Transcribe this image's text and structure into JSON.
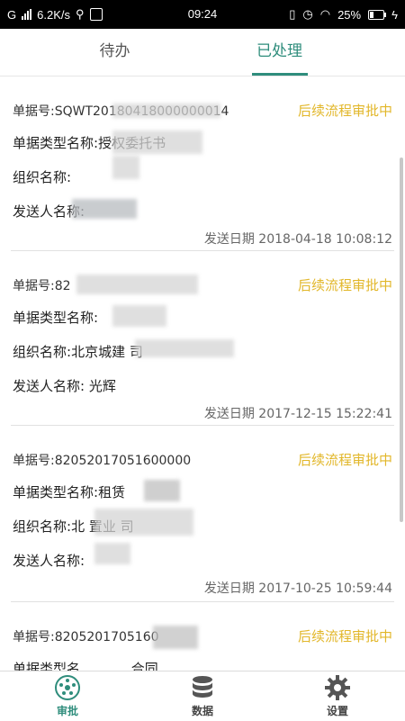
{
  "status_bar": {
    "carrier": "G",
    "speed": "6.2K/s",
    "time": "09:24",
    "battery": "25%"
  },
  "tabs": [
    {
      "label": "待办"
    },
    {
      "label": "已处理"
    }
  ],
  "items": [
    {
      "doc_no_label": "单据号:",
      "doc_no": "SQWT20180418000000014",
      "status": "后续流程审批中",
      "type_label": "单据类型名称:",
      "type_value": "授权委托书",
      "org_label": "组织名称:",
      "org_value": "",
      "sender_label": "发送人名称:",
      "sender_value": "",
      "date": "发送日期 2018-04-18 10:08:12"
    },
    {
      "doc_no_label": "单据号:",
      "doc_no": "82",
      "status": "后续流程审批中",
      "type_label": "单据类型名称:",
      "type_value": "",
      "org_label": "组织名称:",
      "org_value": "北京城建          司",
      "sender_label": "发送人名称:",
      "sender_value": "     光辉",
      "date": "发送日期 2017-12-15 15:22:41"
    },
    {
      "doc_no_label": "单据号:",
      "doc_no": "82052017051600000",
      "status": "后续流程审批中",
      "type_label": "单据类型名称:",
      "type_value": "租赁",
      "org_label": "组织名称:",
      "org_value": "北      置业      司",
      "sender_label": "发送人名称:",
      "sender_value": "",
      "date": "发送日期 2017-10-25 10:59:44"
    },
    {
      "doc_no_label": "单据号:",
      "doc_no": "8205201705160",
      "status": "后续流程审批中",
      "type_label": "单据类型名",
      "type_value": "合同"
    }
  ],
  "bottom_nav": [
    {
      "label": "审批",
      "icon": "approval-icon",
      "active": true
    },
    {
      "label": "数据",
      "icon": "database-icon",
      "active": false
    },
    {
      "label": "设置",
      "icon": "gear-icon",
      "active": false
    }
  ],
  "colors": {
    "accent": "#2f8d7c",
    "status": "#e2b72a"
  }
}
